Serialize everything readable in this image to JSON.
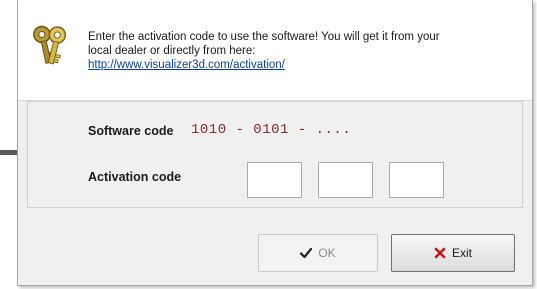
{
  "message": {
    "line1": "Enter the activation code to use the software! You will get it from your",
    "line2": "local dealer or directly from here:",
    "link": "http://www.visualizer3d.com/activation/"
  },
  "form": {
    "software_label": "Software code",
    "software_value": "1010 - 0101 - ....",
    "activation_label": "Activation code",
    "activation_values": [
      "",
      "",
      ""
    ]
  },
  "buttons": {
    "ok_label": "OK",
    "exit_label": "Exit"
  },
  "icons": {
    "header": "keys-icon",
    "ok": "checkmark-icon",
    "exit": "x-icon"
  },
  "colors": {
    "software_code": "#8b2a2a",
    "link": "#0b3ea8",
    "exit_x": "#c0181b"
  }
}
